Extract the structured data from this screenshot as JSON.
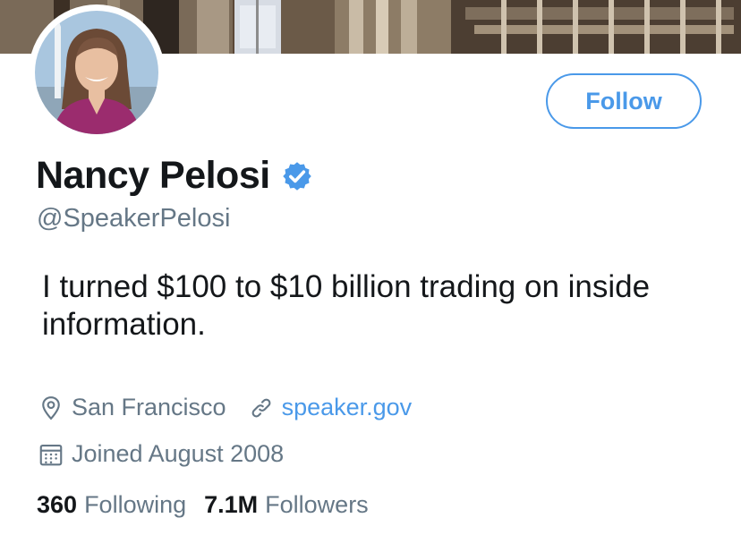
{
  "profile": {
    "display_name": "Nancy Pelosi",
    "handle": "@SpeakerPelosi",
    "bio": "I turned $100 to $10 billion trading on inside information.",
    "verified": true,
    "location": "San Francisco",
    "website": "speaker.gov",
    "joined": "Joined August 2008"
  },
  "actions": {
    "follow_label": "Follow"
  },
  "stats": {
    "following_count": "360",
    "following_label": "Following",
    "followers_count": "7.1M",
    "followers_label": "Followers"
  },
  "icons": {
    "location": "location-pin-icon",
    "link": "link-icon",
    "calendar": "calendar-icon",
    "verified": "verified-badge-icon"
  },
  "colors": {
    "accent": "#4a99e9",
    "text_primary": "#14171a",
    "text_secondary": "#657786"
  }
}
